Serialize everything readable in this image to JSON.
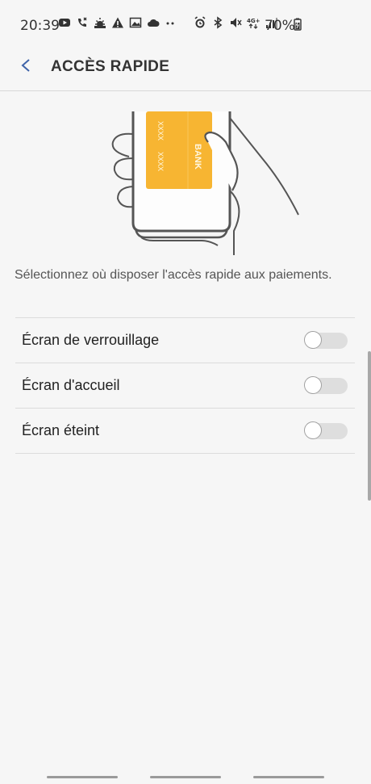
{
  "status_bar": {
    "time": "20:39",
    "battery": "70%",
    "left_icons": [
      "youtube-icon",
      "missed-call-icon",
      "weather-icon",
      "warning-icon",
      "image-icon",
      "cloud-icon",
      "more-dots-icon"
    ],
    "right_icons": [
      "alarm-icon",
      "bluetooth-icon",
      "mute-icon",
      "4g-icon",
      "signal-icon",
      "battery-icon"
    ]
  },
  "header": {
    "title": "ACCÈS RAPIDE"
  },
  "illustration": {
    "card_brand": "BANK",
    "card_digits_1": "XXXX",
    "card_digits_2": "XXXX",
    "card_color": "#f7b532"
  },
  "description": "Sélectionnez où disposer l'accès rapide aux paiements.",
  "settings": [
    {
      "label": "Écran de verrouillage",
      "enabled": false
    },
    {
      "label": "Écran d'accueil",
      "enabled": false
    },
    {
      "label": "Écran éteint",
      "enabled": false
    }
  ],
  "colors": {
    "accent": "#3e63a8",
    "background": "#f6f6f6"
  }
}
